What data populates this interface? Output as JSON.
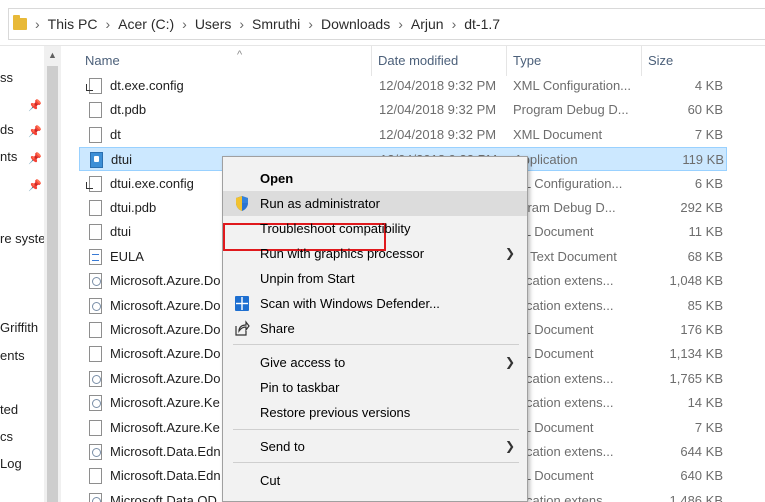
{
  "breadcrumb": {
    "items": [
      "This PC",
      "Acer (C:)",
      "Users",
      "Smruthi",
      "Downloads",
      "Arjun",
      "dt-1.7"
    ]
  },
  "nav": {
    "items": [
      {
        "label": "ss",
        "pinned": false
      },
      {
        "label": "",
        "pinned": true
      },
      {
        "label": "ds",
        "pinned": true
      },
      {
        "label": "nts",
        "pinned": true
      },
      {
        "label": "",
        "pinned": true
      },
      {
        "label": "re syste",
        "pinned": false
      },
      {
        "label": "Griffith",
        "pinned": false
      },
      {
        "label": "ents",
        "pinned": false
      },
      {
        "label": "ted",
        "pinned": false
      },
      {
        "label": "cs",
        "pinned": false
      },
      {
        "label": "Log",
        "pinned": false
      }
    ]
  },
  "columns": {
    "name": "Name",
    "date": "Date modified",
    "type": "Type",
    "size": "Size"
  },
  "files": [
    {
      "name": "dt.exe.config",
      "date": "12/04/2018 9:32 PM",
      "type": "XML Configuration...",
      "size": "4 KB",
      "icon": "shortcut-file-icon"
    },
    {
      "name": "dt.pdb",
      "date": "12/04/2018 9:32 PM",
      "type": "Program Debug D...",
      "size": "60 KB",
      "icon": "file-icon"
    },
    {
      "name": "dt",
      "date": "12/04/2018 9:32 PM",
      "type": "XML Document",
      "size": "7 KB",
      "icon": "file-icon"
    },
    {
      "name": "dtui",
      "date": "12/04/2018 9:32 PM",
      "type": "Application",
      "size": "119 KB",
      "icon": "application-icon"
    },
    {
      "name": "dtui.exe.config",
      "date": "",
      "type": "ML Configuration...",
      "size": "6 KB",
      "icon": "shortcut-file-icon"
    },
    {
      "name": "dtui.pdb",
      "date": "",
      "type": "ogram Debug D...",
      "size": "292 KB",
      "icon": "file-icon"
    },
    {
      "name": "dtui",
      "date": "",
      "type": "ML Document",
      "size": "11 KB",
      "icon": "file-icon"
    },
    {
      "name": "EULA",
      "date": "",
      "type": "ch Text Document",
      "size": "68 KB",
      "icon": "rich-text-icon"
    },
    {
      "name": "Microsoft.Azure.Do",
      "date": "",
      "type": "plication extens...",
      "size": "1,048 KB",
      "icon": "extension-icon"
    },
    {
      "name": "Microsoft.Azure.Do",
      "date": "",
      "type": "plication extens...",
      "size": "85 KB",
      "icon": "extension-icon"
    },
    {
      "name": "Microsoft.Azure.Do",
      "date": "",
      "type": "ML Document",
      "size": "176 KB",
      "icon": "file-icon"
    },
    {
      "name": "Microsoft.Azure.Do",
      "date": "",
      "type": "ML Document",
      "size": "1,134 KB",
      "icon": "file-icon"
    },
    {
      "name": "Microsoft.Azure.Do",
      "date": "",
      "type": "plication extens...",
      "size": "1,765 KB",
      "icon": "extension-icon"
    },
    {
      "name": "Microsoft.Azure.Ke",
      "date": "",
      "type": "plication extens...",
      "size": "14 KB",
      "icon": "extension-icon"
    },
    {
      "name": "Microsoft.Azure.Ke",
      "date": "",
      "type": "ML Document",
      "size": "7 KB",
      "icon": "file-icon"
    },
    {
      "name": "Microsoft.Data.Edn",
      "date": "",
      "type": "plication extens...",
      "size": "644 KB",
      "icon": "extension-icon"
    },
    {
      "name": "Microsoft.Data.Edn",
      "date": "",
      "type": "ML Document",
      "size": "640 KB",
      "icon": "file-icon"
    },
    {
      "name": "Microsoft.Data.OD",
      "date": "",
      "type": "plication extens...",
      "size": "1,486 KB",
      "icon": "extension-icon"
    }
  ],
  "context_menu": {
    "items": [
      {
        "label": "Open",
        "bold": true,
        "submenu": false,
        "icon": ""
      },
      {
        "label": "Run as administrator",
        "bold": false,
        "submenu": false,
        "icon": "uac-shield-icon",
        "hover": true
      },
      {
        "label": "Troubleshoot compatibility",
        "bold": false,
        "submenu": false,
        "icon": ""
      },
      {
        "label": "Run with graphics processor",
        "bold": false,
        "submenu": true,
        "icon": ""
      },
      {
        "label": "Unpin from Start",
        "bold": false,
        "submenu": false,
        "icon": ""
      },
      {
        "label": "Scan with Windows Defender...",
        "bold": false,
        "submenu": false,
        "icon": "windows-defender-icon"
      },
      {
        "label": "Share",
        "bold": false,
        "submenu": false,
        "icon": "share-icon"
      },
      {
        "label": "Give access to",
        "bold": false,
        "submenu": true,
        "icon": ""
      },
      {
        "label": "Pin to taskbar",
        "bold": false,
        "submenu": false,
        "icon": ""
      },
      {
        "label": "Restore previous versions",
        "bold": false,
        "submenu": false,
        "icon": ""
      },
      {
        "label": "Send to",
        "bold": false,
        "submenu": true,
        "icon": ""
      },
      {
        "label": "Cut",
        "bold": false,
        "submenu": false,
        "icon": ""
      }
    ]
  },
  "colors": {
    "selection_bg": "#cce8ff",
    "highlight_border": "#e0191d",
    "menu_bg": "#f2f2f2"
  }
}
